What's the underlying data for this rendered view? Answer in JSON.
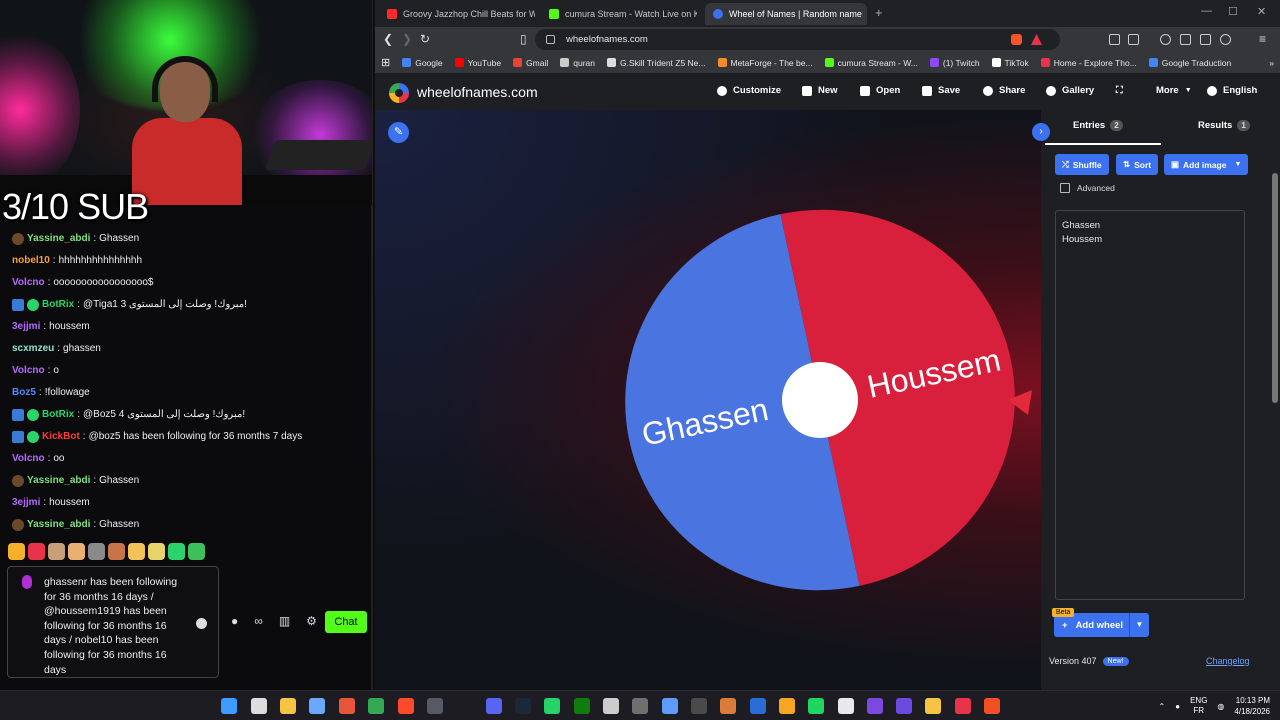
{
  "overlay": {
    "subs": "3/10 SUB"
  },
  "chat": {
    "messages": [
      {
        "user": "Yassine_abdi",
        "color": "#7ee07e",
        "badges": [
          "sub"
        ],
        "text": "Ghassen"
      },
      {
        "user": "nobel10",
        "color": "#ff9c3a",
        "badges": [],
        "text": "hhhhhhhhhhhhhhh"
      },
      {
        "user": "Volcno",
        "color": "#b56bff",
        "badges": [],
        "text": "ooooooooooooooooo$"
      },
      {
        "user": "BotRix",
        "color": "#2bd46a",
        "badges": [
          "bot",
          "ok"
        ],
        "text": "@Tiga1 مبروك! وصلت إلى المستوى 3!"
      },
      {
        "user": "3ejjmi",
        "color": "#b56bff",
        "badges": [],
        "text": "houssem"
      },
      {
        "user": "scxmzeu",
        "color": "#8fe3d0",
        "badges": [],
        "text": "ghassen"
      },
      {
        "user": "Volcno",
        "color": "#b56bff",
        "badges": [],
        "text": "o"
      },
      {
        "user": "Boz5",
        "color": "#4f8cff",
        "badges": [],
        "text": "!followage"
      },
      {
        "user": "BotRix",
        "color": "#2bd46a",
        "badges": [
          "bot",
          "ok"
        ],
        "text": "@Boz5 مبروك! وصلت إلى المستوى 4!"
      },
      {
        "user": "KickBot",
        "color": "#ff3b3b",
        "badges": [
          "bot",
          "ok"
        ],
        "text": "@boz5 has been following for 36 months 7 days"
      },
      {
        "user": "Volcno",
        "color": "#b56bff",
        "badges": [],
        "text": "oo"
      },
      {
        "user": "Yassine_abdi",
        "color": "#7ee07e",
        "badges": [
          "sub"
        ],
        "text": "Ghassen"
      },
      {
        "user": "3ejjmi",
        "color": "#b56bff",
        "badges": [],
        "text": "houssem"
      },
      {
        "user": "Yassine_abdi",
        "color": "#7ee07e",
        "badges": [
          "sub"
        ],
        "text": "Ghassen"
      }
    ],
    "emote_colors": [
      "#f6b12a",
      "#e8344a",
      "#c7a07a",
      "#e9b070",
      "#8a8a8a",
      "#c9734a",
      "#f2c15a",
      "#e6d36a",
      "#2bd46a",
      "#3fbf5a"
    ],
    "input_value": "ghassenr has been following for 36 months 16 days / @houssem1919 has been following for 36 months 16 days / nobel10 has been following for 36 months 16 days",
    "tools": {
      "infinity": "∞"
    },
    "send_label": "Chat"
  },
  "browser": {
    "tabs": [
      {
        "title": "Groovy Jazzhop Chill Beats for Work",
        "fav_color": "#ff2b2b",
        "active": false
      },
      {
        "title": "cumura Stream - Watch Live on Kick",
        "fav_color": "#53fc18",
        "active": false
      },
      {
        "title": "Wheel of Names | Random name",
        "fav_color": "#3c71f0",
        "active": true
      }
    ],
    "url": "wheelofnames.com",
    "bookmarks": [
      {
        "label": "Google",
        "color": "#4285f4"
      },
      {
        "label": "YouTube",
        "color": "#ff0000"
      },
      {
        "label": "Gmail",
        "color": "#ea4335"
      },
      {
        "label": "quran",
        "color": "#cccccc"
      },
      {
        "label": "G.Skill Trident Z5 Ne...",
        "color": "#dddddd"
      },
      {
        "label": "MetaForge - The be...",
        "color": "#f6892a"
      },
      {
        "label": "cumura Stream - W...",
        "color": "#53fc18"
      },
      {
        "label": "(1) Twitch",
        "color": "#9146ff"
      },
      {
        "label": "TikTok",
        "color": "#ffffff"
      },
      {
        "label": "Home - Explore Tho...",
        "color": "#e8344a"
      },
      {
        "label": "Google Traduction",
        "color": "#4285f4"
      }
    ]
  },
  "app": {
    "site_name": "wheelofnames.com",
    "menu": [
      "Customize",
      "New",
      "Open",
      "Save",
      "Share",
      "Gallery",
      "More",
      "English"
    ],
    "wheel": {
      "entries": [
        {
          "label": "Ghassen",
          "color": "#4a74e0"
        },
        {
          "label": "Houssem",
          "color": "#d81f3c"
        }
      ]
    },
    "sidebar": {
      "entries_tab": "Entries",
      "entries_count": "2",
      "results_tab": "Results",
      "results_count": "1",
      "shuffle": "Shuffle",
      "sort": "Sort",
      "add_image": "Add image",
      "advanced": "Advanced",
      "entries_text": [
        "Ghassen",
        "Houssem"
      ],
      "beta": "Beta",
      "add_wheel": "Add wheel",
      "version": "Version 407",
      "new_badge": "New!",
      "changelog": "Changelog"
    }
  },
  "taskbar": {
    "icon_colors": [
      "#3c9cff",
      "#dddddd",
      "#f6c343",
      "#6aa8ff",
      "#e8553a",
      "#34a853",
      "#ff4b2b",
      "#555a66",
      "#5865f2",
      "#1b2838",
      "#25d366",
      "#107c10",
      "#cccccc",
      "#6f6f6f",
      "#5e9bff",
      "#4a4a4a",
      "#d97b3a",
      "#2a6cd6",
      "#f6a623",
      "#1ed760",
      "#e8e8e8",
      "#7a4ae0",
      "#6a4ae0",
      "#f6c343",
      "#e8344a",
      "#f25022"
    ],
    "lang_top": "ENG",
    "lang_bottom": "FR",
    "time": "10:13 PM",
    "date": "4/18/2026"
  }
}
